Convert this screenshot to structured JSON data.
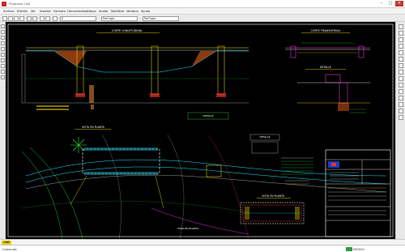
{
  "window": {
    "title": "Programa CAD"
  },
  "menu": [
    "Archivo",
    "Edición",
    "Ver",
    "Insertar",
    "Formato",
    "Herramientas",
    "Dibujo",
    "Acotar",
    "Modificar",
    "Ventana",
    "Ayuda"
  ],
  "toolbar": {
    "layer_combo": "0",
    "style_combo": "PorCapa",
    "linetype_combo": "PorCapa"
  },
  "drawing": {
    "titles": [
      "CORTE LONGITUDINAL",
      "CORTE TRANSVERSAL",
      "DETALLE",
      "DETALLE",
      "DETALLE",
      "VISTA EN PLANTA",
      "VISTA EN PLANTA",
      "VISTA EN PLANTA"
    ]
  },
  "status": {
    "mode_label": "CAD",
    "prompt": "Comando:",
    "state": "MODELO"
  },
  "colors": {
    "bg": "#000000",
    "cyan": "#19e6ff",
    "yellow": "#ffe600",
    "green": "#2ee64a",
    "magenta": "#ff3dff",
    "white": "#ffffff",
    "red": "#ff3030"
  }
}
